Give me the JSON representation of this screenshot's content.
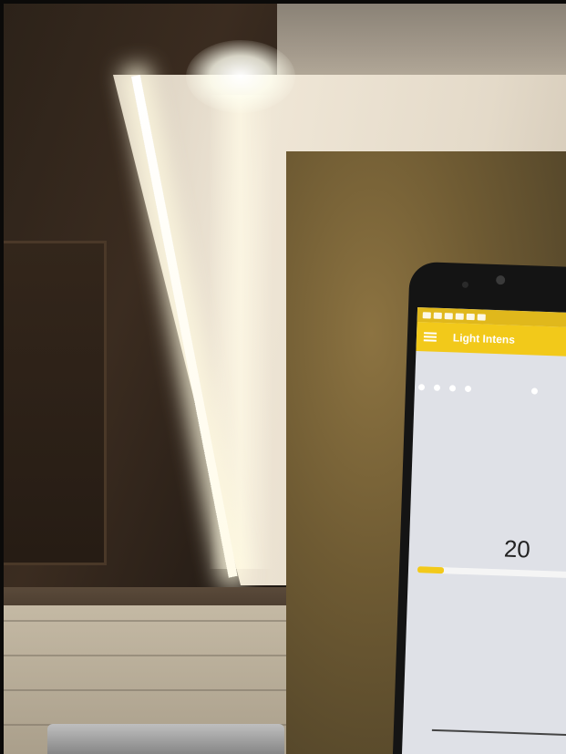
{
  "app": {
    "title": "Light Intens",
    "intensity_value": "20",
    "intensity_fraction": 0.16
  },
  "icons": [
    "hamburger-icon",
    "status-icons"
  ],
  "colors": {
    "app_bar": "#f2c91a",
    "status_bar": "#e0b81c",
    "screen_bg": "#dfe1e7",
    "led_light": "#fffbe9"
  }
}
